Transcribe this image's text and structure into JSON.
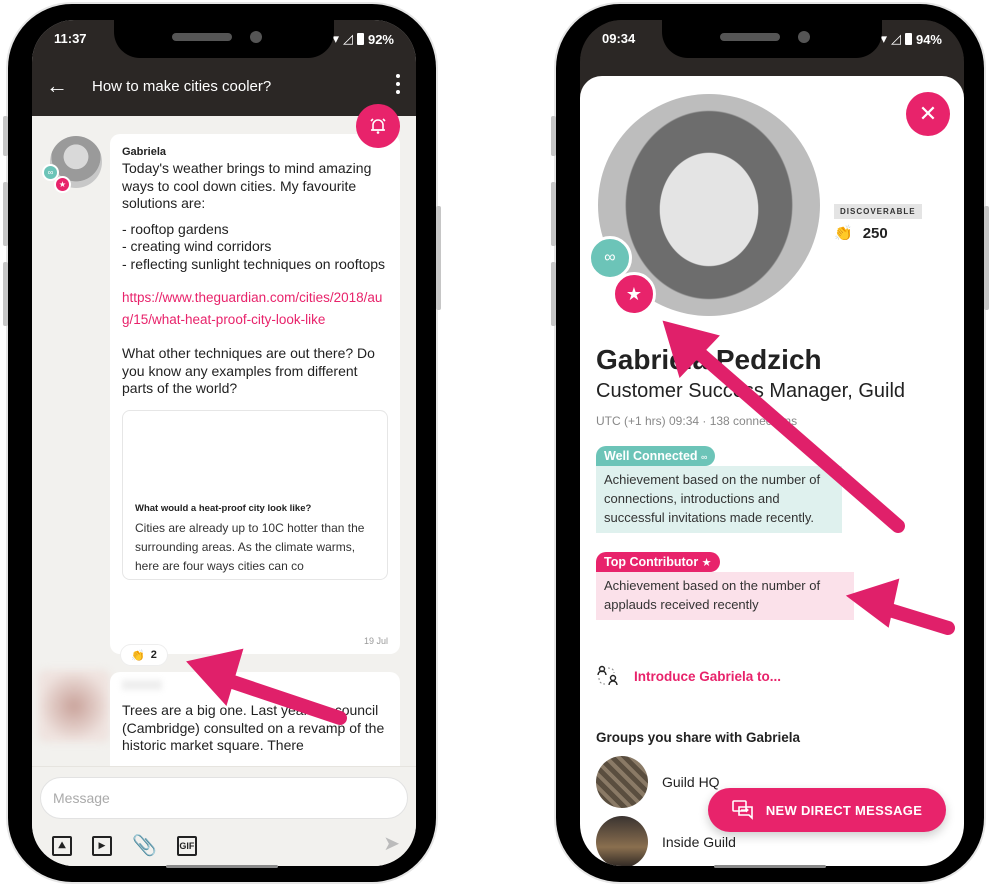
{
  "colors": {
    "brand_pink": "#e8236b",
    "teal": "#6cc4b8",
    "dark_bar": "#2b2725"
  },
  "left_phone": {
    "status": {
      "time": "11:37",
      "battery": "92%"
    },
    "appbar": {
      "back_icon": "arrow-left-icon",
      "title": "How to make cities cooler?",
      "menu_icon": "more-vertical-icon"
    },
    "bell_icon": "bell-alert-icon",
    "post": {
      "author": "Gabriela",
      "paragraph": "Today's weather brings to mind amazing ways to cool down cities. My favourite solutions are:",
      "list": [
        "- rooftop gardens",
        "- creating wind corridors",
        "- reflecting sunlight techniques on rooftops"
      ],
      "link": "https://www.theguardian.com/cities/2018/aug/15/what-heat-proof-city-look-like",
      "question": "What other techniques are out there? Do you know any examples from different parts of the world?",
      "preview": {
        "title": "What would a heat-proof city look like?",
        "body": "Cities are already up to 10C hotter than the surrounding areas. As the climate warms, here are four ways cities can co"
      },
      "date": "19 Jul",
      "applause_count": "2"
    },
    "reply": {
      "text": "Trees are a big one. Last year my council (Cambridge) consulted on a revamp of the historic market square. There"
    },
    "composer": {
      "placeholder": "Message",
      "tools": [
        "image-icon",
        "video-icon",
        "attachment-icon",
        "gif-icon"
      ],
      "gif_label": "GIF",
      "send_icon": "send-icon"
    }
  },
  "right_phone": {
    "status": {
      "time": "09:34",
      "battery": "94%"
    },
    "close_icon": "close-icon",
    "discoverable_label": "DISCOVERABLE",
    "applause_total": "250",
    "name": "Gabriela Pedzich",
    "role": "Customer Success Manager, Guild",
    "meta": "UTC (+1 hrs) 09:34  · 138 connections",
    "achievements": [
      {
        "tag": "Well Connected",
        "tag_icon": "link-icon",
        "description": "Achievement based on the number of connections, introductions and successful invitations made recently."
      },
      {
        "tag": "Top Contributor",
        "tag_icon": "star-icon",
        "description": "Achievement based on the number of applauds received recently"
      }
    ],
    "introduce_label": "Introduce Gabriela to...",
    "groups_title": "Groups you share with Gabriela",
    "groups": [
      {
        "name": "Guild HQ"
      },
      {
        "name": "Inside Guild"
      }
    ],
    "dm_button": "NEW DIRECT MESSAGE"
  }
}
